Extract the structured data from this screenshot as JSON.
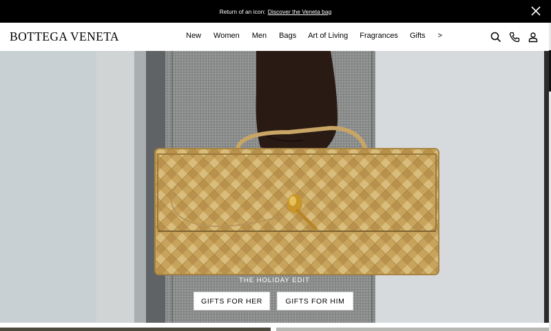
{
  "banner": {
    "prefix": "Return of an icon:",
    "link": "Discover the Veneta bag"
  },
  "brand": {
    "logo": "BOTTEGA VENETA"
  },
  "nav": {
    "items": [
      "New",
      "Women",
      "Men",
      "Bags",
      "Art of Living",
      "Fragrances",
      "Gifts"
    ],
    "more_label": ">"
  },
  "header_icons": [
    "search-icon",
    "phone-icon",
    "account-icon"
  ],
  "hero": {
    "eyebrow": "THE HOLIDAY EDIT",
    "buttons": [
      "GIFTS FOR HER",
      "GIFTS FOR HIM"
    ]
  },
  "colors": {
    "banner_bg": "#000000",
    "bag_gold": "#c8a35c",
    "coat_grey": "#8c8e8c"
  }
}
